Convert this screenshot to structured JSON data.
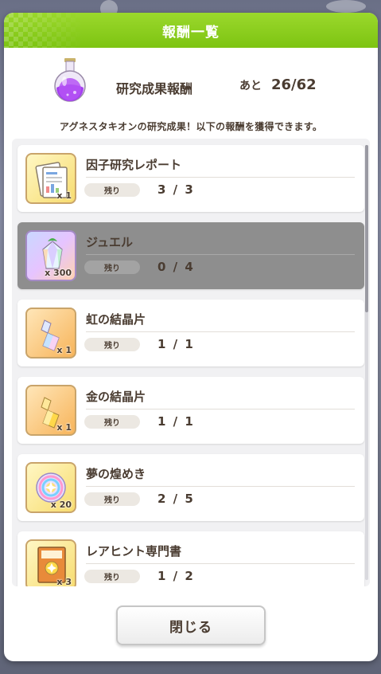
{
  "dialog": {
    "title": "報酬一覧",
    "summary_title": "研究成果報酬",
    "remaining_label": "あと",
    "remaining_value": "26/62",
    "description": "アグネスタキオンの研究成果！以下の報酬を獲得できます。",
    "close_label": "閉じる"
  },
  "rewards": [
    {
      "name": "因子研究レポート",
      "qty": "x 1",
      "remaining_label": "残り",
      "count": "3 / 3",
      "icon": "report-icon",
      "claimed": false
    },
    {
      "name": "ジュエル",
      "qty": "x 300",
      "remaining_label": "残り",
      "count": "0 / 4",
      "icon": "jewel-icon",
      "claimed": true
    },
    {
      "name": "虹の結晶片",
      "qty": "x 1",
      "remaining_label": "残り",
      "count": "1 / 1",
      "icon": "rainbow-crystal-icon",
      "claimed": false
    },
    {
      "name": "金の結晶片",
      "qty": "x 1",
      "remaining_label": "残り",
      "count": "1 / 1",
      "icon": "gold-crystal-icon",
      "claimed": false
    },
    {
      "name": "夢の煌めき",
      "qty": "x 20",
      "remaining_label": "残り",
      "count": "2 / 5",
      "icon": "dream-sparkle-icon",
      "claimed": false
    },
    {
      "name": "レアヒント専門書",
      "qty": "x 3",
      "remaining_label": "残り",
      "count": "1 / 2",
      "icon": "hint-book-icon",
      "claimed": false
    }
  ],
  "colors": {
    "header_green": "#8ccf1e",
    "text_brown": "#4a3c31",
    "claimed_row": "#8e8e8e"
  }
}
